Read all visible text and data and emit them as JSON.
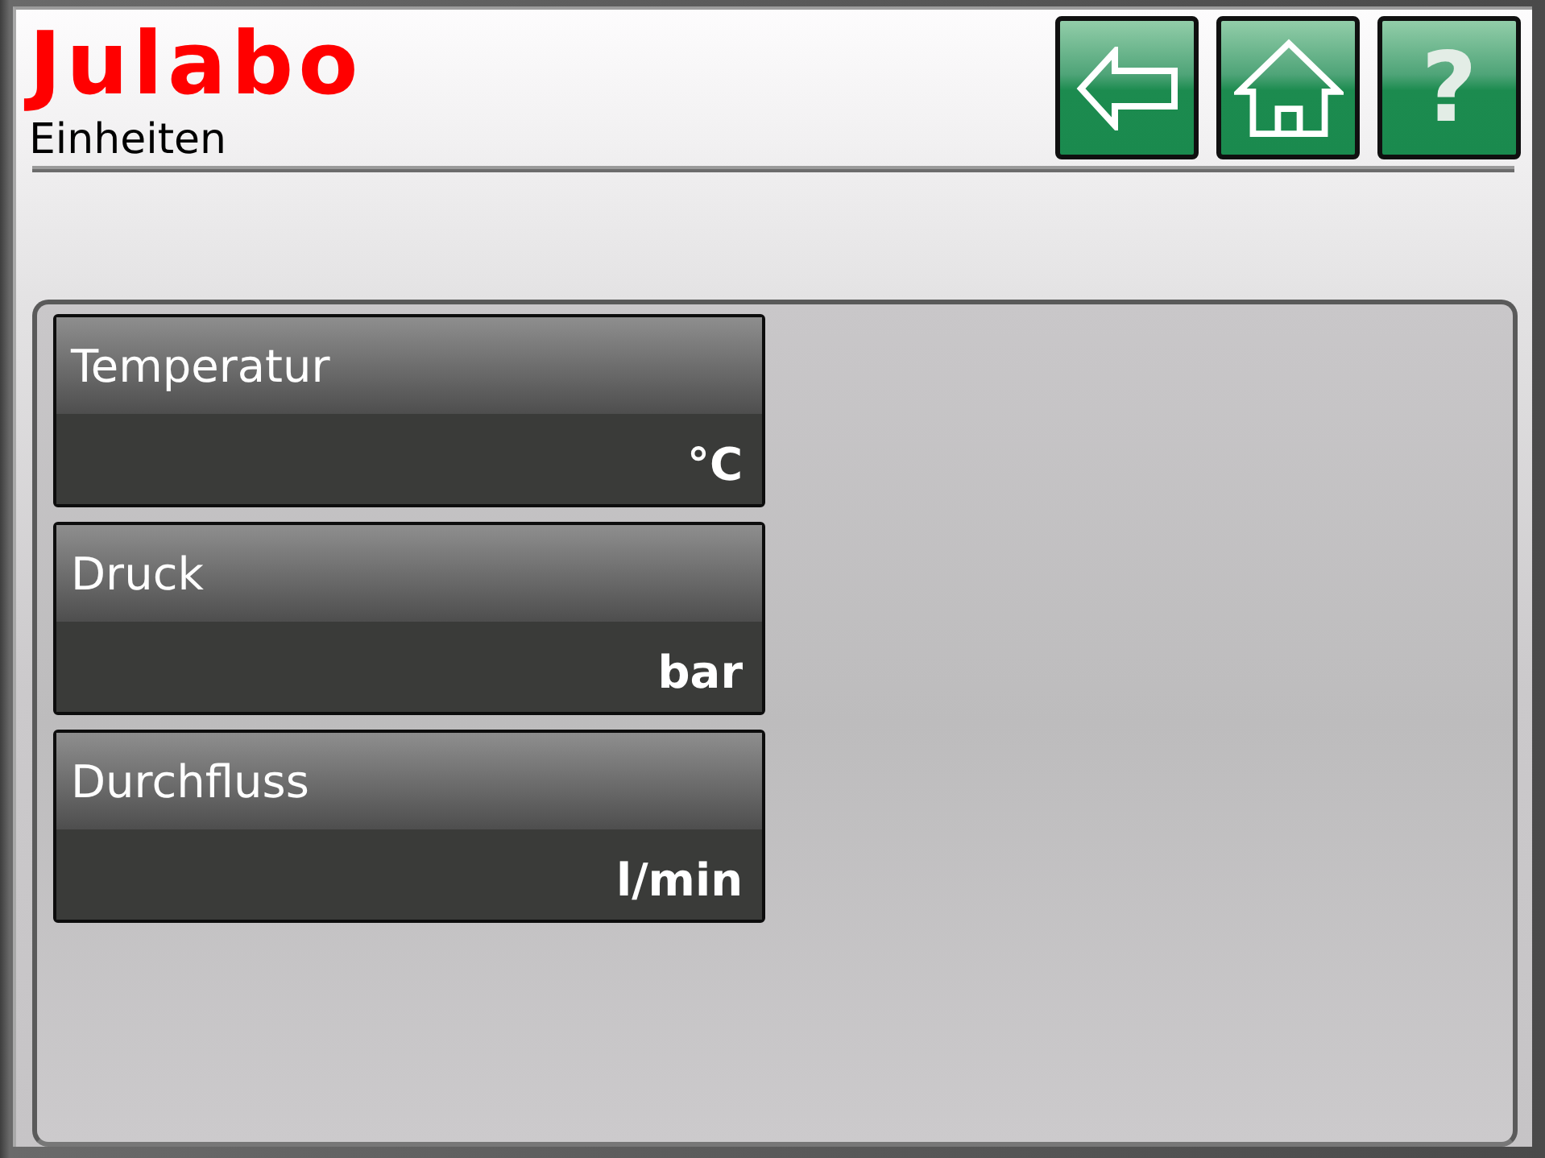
{
  "header": {
    "logo": "Julabo",
    "title": "Einheiten"
  },
  "nav_buttons": [
    {
      "kind": "back"
    },
    {
      "kind": "home"
    },
    {
      "kind": "help",
      "label": "?"
    }
  ],
  "units": [
    {
      "label": "Temperatur",
      "value": "°C"
    },
    {
      "label": "Druck",
      "value": "bar"
    },
    {
      "label": "Durchfluss",
      "value": "l/min"
    }
  ]
}
